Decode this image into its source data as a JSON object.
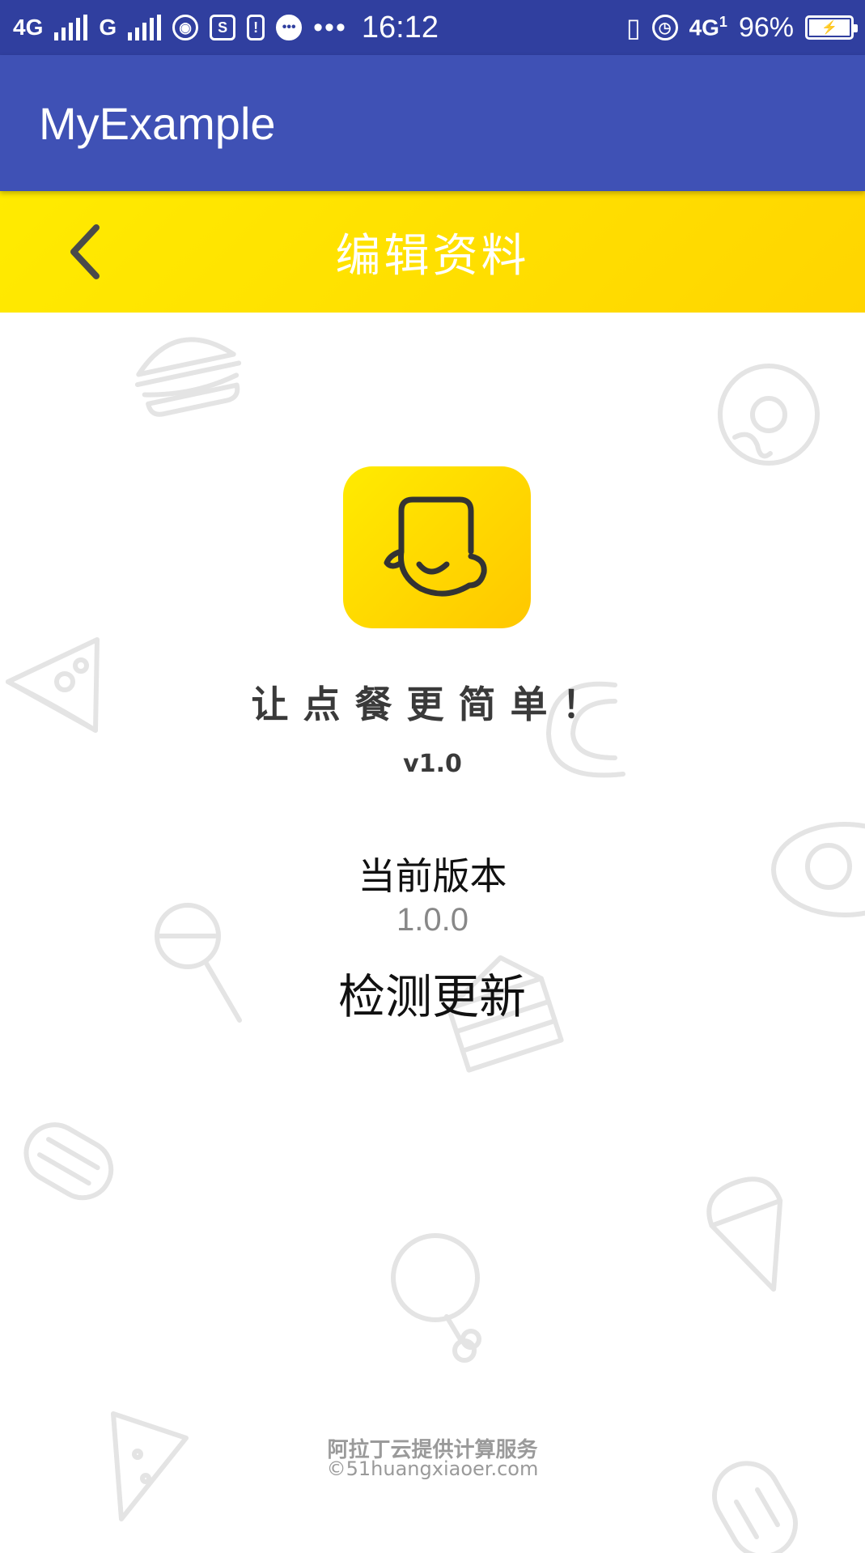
{
  "status_bar": {
    "network1": "4G",
    "network2": "G",
    "time": "16:12",
    "network3": "4G",
    "network3_sub": "1",
    "battery_percent": "96%"
  },
  "app_bar": {
    "title": "MyExample"
  },
  "header": {
    "title": "编辑资料",
    "back_icon": "chevron-left-icon"
  },
  "about": {
    "slogan": "让点餐更简单！",
    "app_version": "v1.0",
    "current_version_label": "当前版本",
    "current_version_value": "1.0.0",
    "check_update_label": "检测更新"
  },
  "footer": {
    "provider": "阿拉丁云提供计算服务",
    "copyright": "©51huangxiaoer.com"
  },
  "colors": {
    "status_bar": "#303F9F",
    "app_bar": "#3F51B5",
    "header_yellow": "#FFD500",
    "logo_yellow": "#FFE100"
  }
}
